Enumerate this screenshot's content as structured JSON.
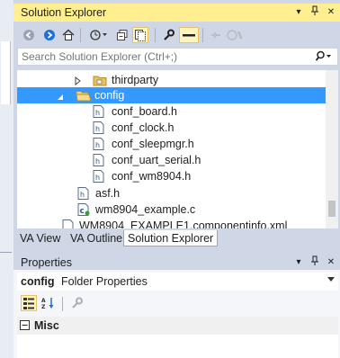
{
  "solution_explorer": {
    "title": "Solution Explorer",
    "search_placeholder": "Search Solution Explorer (Ctrl+;)",
    "tree": {
      "thirdparty": "thirdparty",
      "config": "config",
      "config_files": [
        "conf_board.h",
        "conf_clock.h",
        "conf_sleepmgr.h",
        "conf_uart_serial.h",
        "conf_wm8904.h"
      ],
      "asf": "asf.h",
      "example": "wm8904_example.c",
      "componentinfo": "WM8904_EXAMPLE1.componentinfo.xml"
    },
    "tabs": [
      "VA View",
      "VA Outline",
      "Solution Explorer"
    ],
    "active_tab": "Solution Explorer"
  },
  "properties": {
    "title": "Properties",
    "object_name": "config",
    "object_type": "Folder Properties",
    "category": "Misc"
  },
  "icons": {
    "header_file": "h",
    "csource_file": "c",
    "grid_expand": "+",
    "grid_collapse": "−",
    "title_dropdown": "▾",
    "title_close": "✕"
  },
  "colors": {
    "title_bar": "#ffef91",
    "selection": "#3399ff",
    "chrome": "#cfd6e5"
  }
}
